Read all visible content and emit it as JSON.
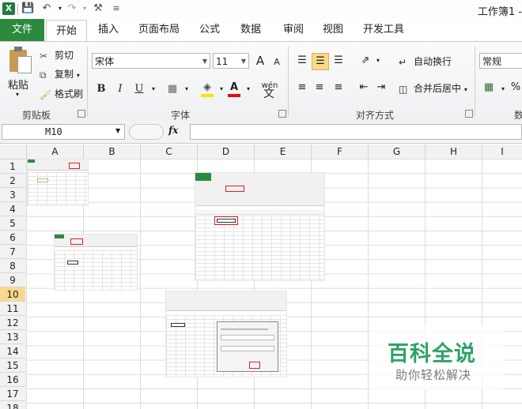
{
  "title_bar": {
    "app_icon": "X",
    "icons": [
      "excel-app-icon",
      "save-icon",
      "undo-icon",
      "redo-icon",
      "tools-icon",
      "customize-qat-icon"
    ],
    "workbook_title": "工作簿1 -"
  },
  "tabs": [
    "文件",
    "开始",
    "插入",
    "页面布局",
    "公式",
    "数据",
    "审阅",
    "视图",
    "开发工具"
  ],
  "selected_tab": "开始",
  "ribbon": {
    "clipboard": {
      "paste": "粘贴",
      "cut": "剪切",
      "copy": "复制",
      "format_painter": "格式刷",
      "label": "剪贴板"
    },
    "font": {
      "font_name": "宋体",
      "font_size": "11",
      "grow": "A",
      "shrink": "A",
      "bold": "B",
      "italic": "I",
      "underline": "U",
      "phonetic": "wén",
      "label": "字体"
    },
    "alignment": {
      "wrap_text": "自动换行",
      "merge_center": "合并后居中",
      "label": "对齐方式"
    },
    "number": {
      "format": "常规",
      "percent": "%",
      "label": "数"
    }
  },
  "formula_bar": {
    "name_box": "M10",
    "fx": "fx",
    "formula": ""
  },
  "columns": [
    "A",
    "B",
    "C",
    "D",
    "E",
    "F",
    "G",
    "H",
    "I"
  ],
  "rows": [
    "1",
    "2",
    "3",
    "4",
    "5",
    "6",
    "7",
    "8",
    "9",
    "10",
    "11",
    "12",
    "13",
    "14",
    "15",
    "16",
    "17",
    "18"
  ],
  "active_cell": {
    "column": "M",
    "row": "10"
  },
  "watermark": {
    "main": "百科全说",
    "sub": "助你轻松解决",
    "color": "#2ea36b"
  }
}
